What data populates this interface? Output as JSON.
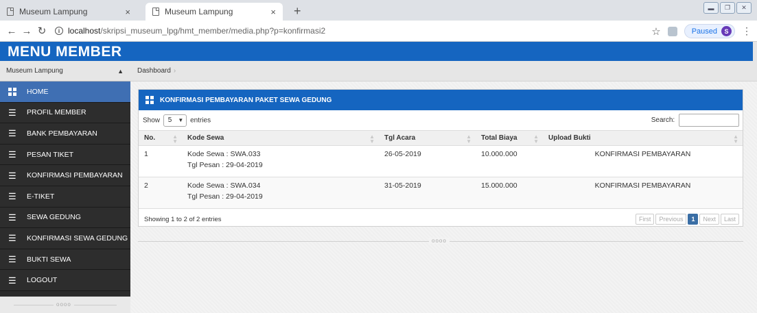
{
  "browser": {
    "tabs": [
      {
        "title": "Museum Lampung",
        "active": false
      },
      {
        "title": "Museum Lampung",
        "active": true
      }
    ],
    "new_tab": "+",
    "tab_close": "×",
    "url_host": "localhost",
    "url_path": "/skripsi_museum_lpg/hmt_member/media.php?p=konfirmasi2",
    "profile_status": "Paused",
    "profile_initial": "S"
  },
  "header": {
    "title": "MENU MEMBER"
  },
  "sidebar": {
    "select_label": "Museum Lampung",
    "items": [
      {
        "label": "HOME",
        "active": true
      },
      {
        "label": "PROFIL MEMBER"
      },
      {
        "label": "BANK PEMBAYARAN"
      },
      {
        "label": "PESAN TIKET"
      },
      {
        "label": "KONFIRMASI PEMBAYARAN"
      },
      {
        "label": "E-TIKET"
      },
      {
        "label": "SEWA GEDUNG"
      },
      {
        "label": "KONFIRMASI SEWA GEDUNG"
      },
      {
        "label": "BUKTI SEWA"
      },
      {
        "label": "LOGOUT"
      }
    ],
    "footer_mark": "oooo"
  },
  "breadcrumb": {
    "item": "Dashboard"
  },
  "panel": {
    "title": "KONFIRMASI PEMBAYARAN PAKET SEWA GEDUNG",
    "show_label": "Show",
    "entries_value": "5",
    "entries_label": "entries",
    "search_label": "Search:",
    "search_value": "",
    "columns": [
      "No.",
      "Kode Sewa",
      "Tgl Acara",
      "Total Biaya",
      "Upload Bukti"
    ],
    "rows": [
      {
        "no": "1",
        "kode": "Kode Sewa : SWA.033",
        "tgl_pesan": "Tgl Pesan : 29-04-2019",
        "tgl_acara": "26-05-2019",
        "total": "10.000.000",
        "upload": "KONFIRMASI PEMBAYARAN"
      },
      {
        "no": "2",
        "kode": "Kode Sewa : SWA.034",
        "tgl_pesan": "Tgl Pesan : 29-04-2019",
        "tgl_acara": "31-05-2019",
        "total": "15.000.000",
        "upload": "KONFIRMASI PEMBAYARAN"
      }
    ],
    "info": "Showing 1 to 2 of 2 entries",
    "pager": {
      "first": "First",
      "previous": "Previous",
      "current": "1",
      "next": "Next",
      "last": "Last"
    }
  },
  "divider_mark": "oooo",
  "colors": {
    "brand_blue": "#1565c0",
    "sidebar_bg": "#2d2d2d",
    "sidebar_active": "#3f6fb3"
  }
}
